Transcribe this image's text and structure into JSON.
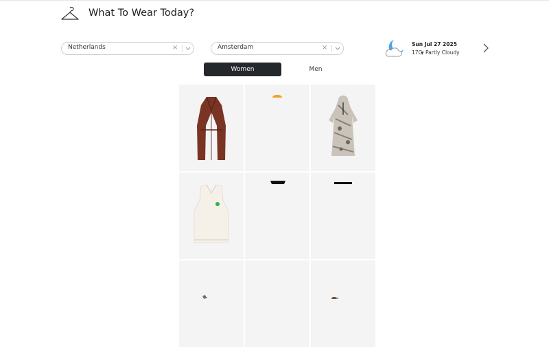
{
  "app": {
    "title": "What To Wear Today?"
  },
  "location": {
    "country": "Netherlands",
    "city": "Amsterdam",
    "clear_glyph": "×"
  },
  "weather": {
    "date": "Sun Jul 27 2025",
    "temp": "17C",
    "condition": "Partly Cloudy",
    "icon": "moon-cloud-icon"
  },
  "tabs": [
    {
      "label": "Women",
      "active": true
    },
    {
      "label": "Men",
      "active": false
    }
  ],
  "products": [
    {
      "name": "leather-trench-coat",
      "color": "#7a3424"
    },
    {
      "name": "orange-item",
      "color": "#f0a020"
    },
    {
      "name": "printed-hooded-dress",
      "color": "#8a8178"
    },
    {
      "name": "knit-vest",
      "color": "#f3efe6"
    },
    {
      "name": "black-top",
      "color": "#111111"
    },
    {
      "name": "black-strap",
      "color": "#111111"
    },
    {
      "name": "small-accessory",
      "color": "#777777"
    },
    {
      "name": "empty",
      "color": "#f4f4f4"
    },
    {
      "name": "brown-accessory",
      "color": "#6b4a30"
    }
  ]
}
